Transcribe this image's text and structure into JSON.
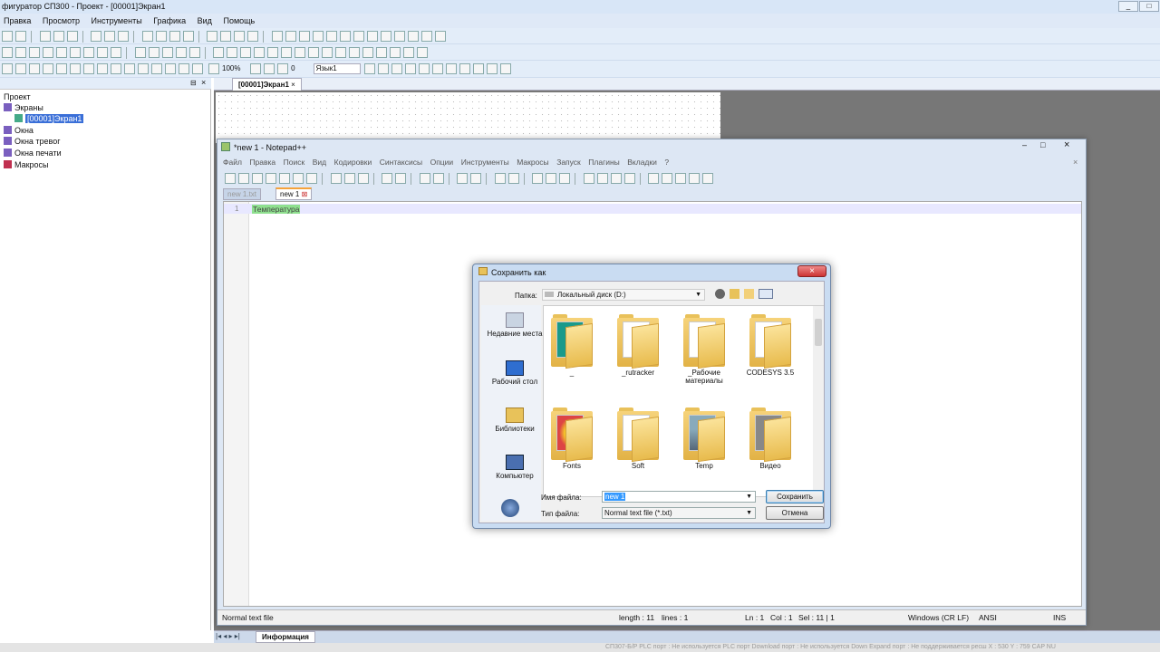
{
  "app": {
    "title": "фигуратор СП300 - Проект - [00001]Экран1",
    "menu": [
      "Правка",
      "Просмотр",
      "Инструменты",
      "Графика",
      "Вид",
      "Помощь"
    ],
    "zoom": "100%",
    "field_value": "0",
    "language": "Язык1",
    "doc_tab": "[00001]Экран1",
    "tree_root": "Проект",
    "tree_items": [
      "Экраны",
      "[00001]Экран1",
      "Окна",
      "Окна тревог",
      "Окна печати",
      "Макросы"
    ],
    "info_tab": "Информация",
    "status_text": "СП307-Б/Р      PLC порт : Не используется PLC порт    Download порт : Не используется Down Expand порт : Не поддерживается ресш X : 530  Y : 759        CAP  NU"
  },
  "notepad": {
    "title": "*new 1 - Notepad++",
    "menu": [
      "Файл",
      "Правка",
      "Поиск",
      "Вид",
      "Кодировки",
      "Синтаксисы",
      "Опции",
      "Инструменты",
      "Макросы",
      "Запуск",
      "Плагины",
      "Вкладки",
      "?"
    ],
    "tabs": [
      "new 1.txt",
      "new 1"
    ],
    "line_number": "1",
    "line_text": "Температура",
    "status": {
      "type": "Normal text file",
      "length": "length : 11",
      "lines": "lines : 1",
      "ln": "Ln : 1",
      "col": "Col : 1",
      "sel": "Sel : 11 | 1",
      "eol": "Windows (CR LF)",
      "enc": "ANSI",
      "ins": "INS"
    }
  },
  "dialog": {
    "title": "Сохранить как",
    "folder_label": "Папка:",
    "folder_value": "Локальный диск (D:)",
    "sidebar": [
      "Недавние места",
      "Рабочий стол",
      "Библиотеки",
      "Компьютер"
    ],
    "folders": [
      "_",
      "_rutracker",
      "_Рабочие материалы",
      "CODESYS 3.5",
      "Fonts",
      "Soft",
      "Temp",
      "Видео"
    ],
    "filename_label": "Имя файла:",
    "filename_value": "new 1",
    "filetype_label": "Тип файла:",
    "filetype_value": "Normal text file (*.txt)",
    "save_btn": "Сохранить",
    "cancel_btn": "Отмена"
  },
  "colors": {
    "accent": "#3399ff",
    "selection": "#3a6fd8",
    "highlight_text": "#8fe08f"
  }
}
